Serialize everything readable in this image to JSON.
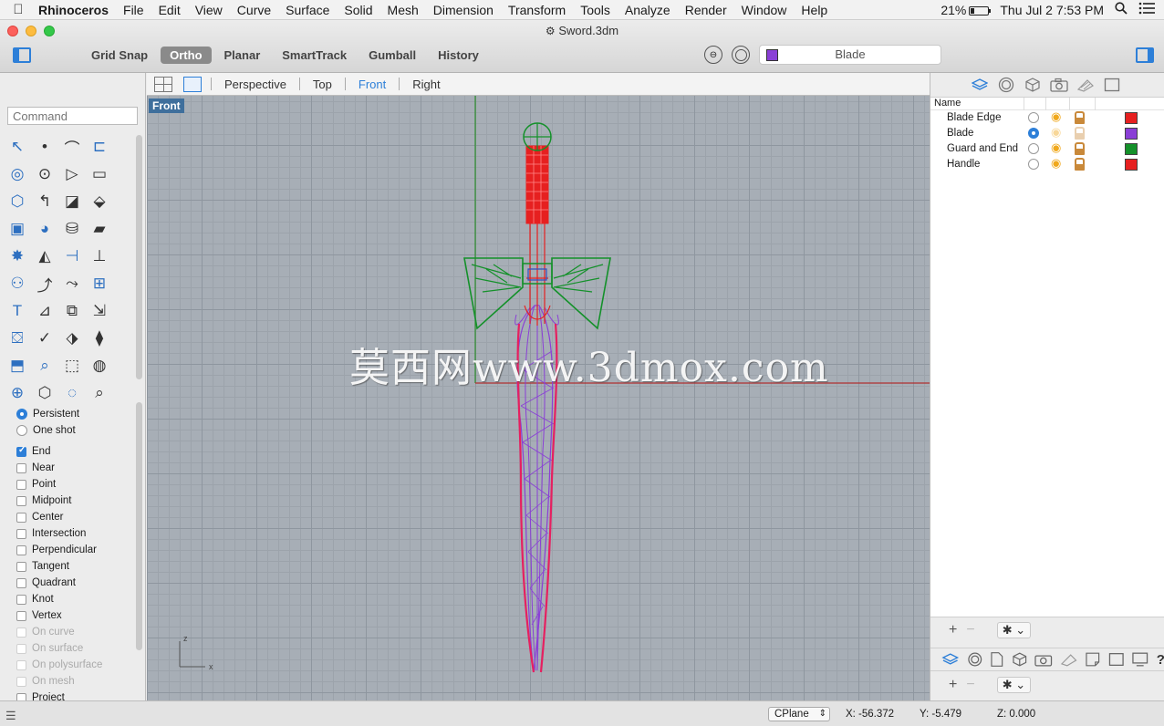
{
  "menubar": {
    "app": "Rhinoceros",
    "items": [
      "File",
      "Edit",
      "View",
      "Curve",
      "Surface",
      "Solid",
      "Mesh",
      "Dimension",
      "Transform",
      "Tools",
      "Analyze",
      "Render",
      "Window",
      "Help"
    ],
    "battery": "21%",
    "clock": "Thu Jul 2  7:53 PM"
  },
  "window": {
    "title": "Sword.3dm"
  },
  "toolbar": {
    "modes": [
      {
        "label": "Grid Snap",
        "active": false
      },
      {
        "label": "Ortho",
        "active": true
      },
      {
        "label": "Planar",
        "active": false
      },
      {
        "label": "SmartTrack",
        "active": false
      },
      {
        "label": "Gumball",
        "active": false
      },
      {
        "label": "History",
        "active": false
      }
    ],
    "current_layer": "Blade",
    "current_layer_color": "#8a3fd6"
  },
  "command": {
    "placeholder": "Command"
  },
  "tool_icons": [
    "select-arrow-icon",
    "point-icon",
    "polyline-icon",
    "curve-icon",
    "circle-icon",
    "ellipse-icon",
    "polygon-icon",
    "rectangle-icon",
    "polygon-solid-icon",
    "fillet-curve-icon",
    "surface-patch-icon",
    "loft-icon",
    "box-solid-icon",
    "sphere-group-icon",
    "cylinder-icon",
    "mesh-surface-icon",
    "explode-icon",
    "boolean-icon",
    "extend-icon",
    "split-icon",
    "group-icon",
    "connect-icon",
    "curve-edit-icon",
    "array-icon",
    "text-icon",
    "dimension-icon",
    "block-icon",
    "transform-icon",
    "solid-tools-icon",
    "measure-icon",
    "grid-array-icon",
    "mirror-icon",
    "extrude-icon",
    "check-icon",
    "render-icon",
    "light-icon",
    "zoom-icon",
    "zoom-window-icon",
    "zoom-extents-icon",
    "search-icon"
  ],
  "osnap": {
    "mode_options": [
      {
        "label": "Persistent",
        "selected": true
      },
      {
        "label": "One shot",
        "selected": false
      }
    ],
    "snaps": [
      {
        "label": "End",
        "checked": true,
        "enabled": true
      },
      {
        "label": "Near",
        "checked": false,
        "enabled": true
      },
      {
        "label": "Point",
        "checked": false,
        "enabled": true
      },
      {
        "label": "Midpoint",
        "checked": false,
        "enabled": true
      },
      {
        "label": "Center",
        "checked": false,
        "enabled": true
      },
      {
        "label": "Intersection",
        "checked": false,
        "enabled": true
      },
      {
        "label": "Perpendicular",
        "checked": false,
        "enabled": true
      },
      {
        "label": "Tangent",
        "checked": false,
        "enabled": true
      },
      {
        "label": "Quadrant",
        "checked": false,
        "enabled": true
      },
      {
        "label": "Knot",
        "checked": false,
        "enabled": true
      },
      {
        "label": "Vertex",
        "checked": false,
        "enabled": true
      },
      {
        "label": "On curve",
        "checked": false,
        "enabled": false
      },
      {
        "label": "On surface",
        "checked": false,
        "enabled": false
      },
      {
        "label": "On polysurface",
        "checked": false,
        "enabled": false
      },
      {
        "label": "On mesh",
        "checked": false,
        "enabled": false
      },
      {
        "label": "Project",
        "checked": false,
        "enabled": true
      }
    ]
  },
  "viewports": {
    "tabs": [
      "Perspective",
      "Top",
      "Front",
      "Right"
    ],
    "active": "Front",
    "active_label": "Front",
    "watermark": "莫西网www.3dmox.com",
    "axis_labels": {
      "z": "z",
      "x": "x"
    }
  },
  "layers_panel": {
    "column_name": "Name",
    "layers": [
      {
        "name": "Blade Edge",
        "current": false,
        "color": "#e62020"
      },
      {
        "name": "Blade",
        "current": true,
        "color": "#8a3fd6"
      },
      {
        "name": "Guard and End",
        "current": false,
        "color": "#14912a"
      },
      {
        "name": "Handle",
        "current": false,
        "color": "#e62020"
      }
    ],
    "add_symbol": "+",
    "remove_symbol": "−",
    "gear_symbol": "✱ ⌄"
  },
  "status": {
    "cplane": "CPlane",
    "x": "X: -56.372",
    "y": "Y: -5.479",
    "z": "Z: 0.000"
  }
}
